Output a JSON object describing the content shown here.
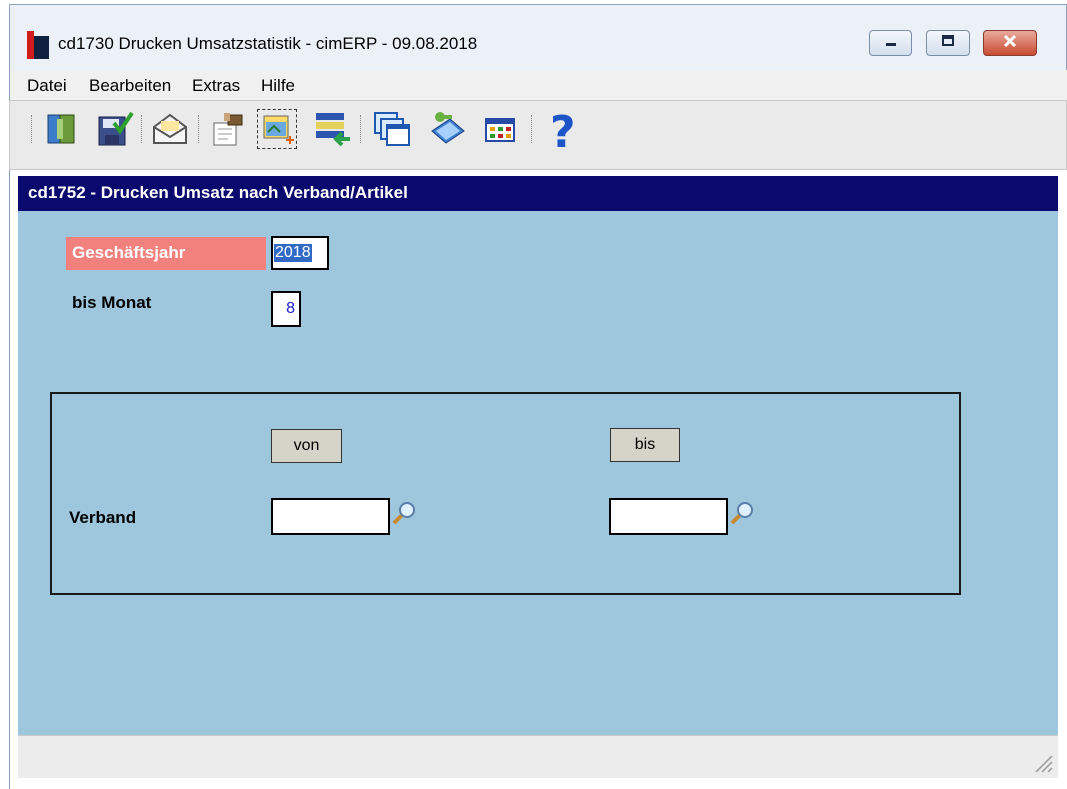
{
  "window": {
    "title": "cd1730 Drucken Umsatzstatistik - cimERP - 09.08.2018",
    "controls": [
      "minimize-icon",
      "maximize-icon",
      "close-icon"
    ]
  },
  "menu": {
    "items": [
      "Datei",
      "Bearbeiten",
      "Extras",
      "Hilfe"
    ]
  },
  "toolbar": {
    "icons": [
      "exit-door-icon",
      "save-check-icon",
      "envelope-icon",
      "edit-stamp-icon",
      "print-preview-icon",
      "export-list-icon",
      "windows-cascade-icon",
      "book-key-icon",
      "grid-table-icon",
      "help-question-icon"
    ]
  },
  "form": {
    "header": "cd1752 - Drucken Umsatz nach Verband/Artikel",
    "geschaeftsjahr_label": "Geschäftsjahr",
    "geschaeftsjahr_value": "2018",
    "bis_monat_label": "bis Monat",
    "bis_monat_value": "8",
    "group": {
      "von_label": "von",
      "bis_label": "bis",
      "verband_label": "Verband",
      "verband_von_value": "",
      "verband_bis_value": ""
    }
  },
  "colors": {
    "header_bg": "#0a0a6e",
    "content_bg": "#9ec6dd",
    "required_label_bg": "#f2817e",
    "selection": "#316ac5"
  }
}
